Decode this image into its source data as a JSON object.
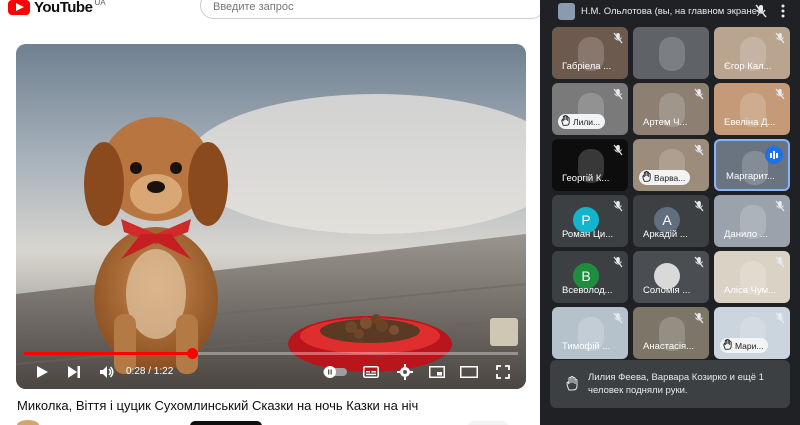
{
  "youtube": {
    "logo_text": "YouTube",
    "logo_country": "UA",
    "search_placeholder": "Введите запрос",
    "video_title": "Миколка, Віття і цуцик Сухомлинський Сказки на ночь Казки на ніч",
    "player": {
      "time": "0:28 / 1:22",
      "progress": 0.34
    }
  },
  "meet": {
    "header_name": "Н.М. Ольлотова (вы, на главном экране)",
    "tiles": [
      {
        "name": "Габріела ...",
        "muted": true,
        "kind": "video",
        "bg": "#6d5a4e"
      },
      {
        "name": "",
        "muted": false,
        "kind": "screen",
        "bg": "#5f6368"
      },
      {
        "name": "Єгор Кал...",
        "muted": true,
        "kind": "video",
        "bg": "#b9a48f"
      },
      {
        "name": "Лили...",
        "muted": true,
        "kind": "hand",
        "bg": "#7a7a7a"
      },
      {
        "name": "Артем Ч...",
        "muted": true,
        "kind": "video",
        "bg": "#8d7f72"
      },
      {
        "name": "Евеліна Д...",
        "muted": true,
        "kind": "video",
        "bg": "#c49a78"
      },
      {
        "name": "Георгій К...",
        "muted": true,
        "kind": "video",
        "bg": "#0d0d0d"
      },
      {
        "name": "Варва...",
        "muted": true,
        "kind": "hand",
        "bg": "#9b8c7c"
      },
      {
        "name": "Маргарит...",
        "muted": false,
        "kind": "speaking",
        "bg": "#6a7380"
      },
      {
        "name": "Роман Ци...",
        "muted": true,
        "kind": "initial",
        "initial": "Р",
        "color": "#12b5cb"
      },
      {
        "name": "Аркадій ...",
        "muted": true,
        "kind": "initial",
        "initial": "А",
        "color": "#5f6f7f"
      },
      {
        "name": "Данило ...",
        "muted": true,
        "kind": "video",
        "bg": "#9aa3ab"
      },
      {
        "name": "Всеволод...",
        "muted": true,
        "kind": "initial",
        "initial": "В",
        "color": "#1e8e3e"
      },
      {
        "name": "Соломія ...",
        "muted": true,
        "kind": "avatar",
        "bg": "#4a4d51"
      },
      {
        "name": "Аліса Чум...",
        "muted": true,
        "kind": "video",
        "bg": "#d9d2c5"
      },
      {
        "name": "Тимофій ...",
        "muted": true,
        "kind": "video",
        "bg": "#b5c2cc"
      },
      {
        "name": "Анастасія...",
        "muted": true,
        "kind": "video",
        "bg": "#7d7668"
      },
      {
        "name": "Мари...",
        "muted": true,
        "kind": "hand",
        "bg": "#cbd5dd"
      }
    ],
    "toast_text": "Лилия Феева, Варвара Козирко и ещё 1 человек подняли руки."
  }
}
